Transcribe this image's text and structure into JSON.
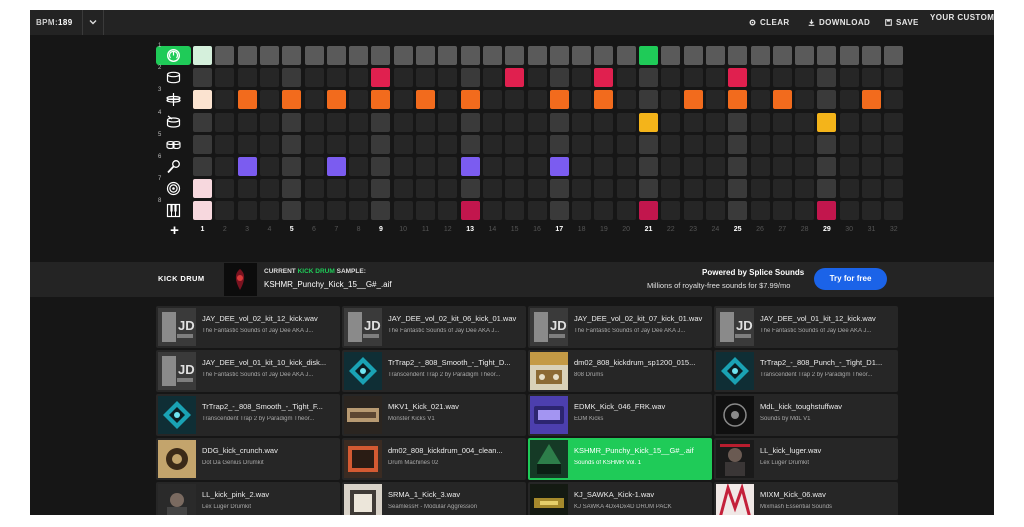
{
  "topbar": {
    "bpm_label": "BPM:",
    "bpm_value": "189",
    "clear_label": "CLEAR",
    "download_label": "DOWNLOAD",
    "save_label": "SAVE",
    "custom_label": "YOUR CUSTOM I"
  },
  "sequencer": {
    "rows": [
      {
        "num": "1",
        "icon": "volume-knob-icon",
        "active": true
      },
      {
        "num": "2",
        "icon": "kick-drum-icon",
        "active": false
      },
      {
        "num": "3",
        "icon": "hihat-cymbal-icon",
        "active": false
      },
      {
        "num": "4",
        "icon": "snare-drum-icon",
        "active": false
      },
      {
        "num": "5",
        "icon": "tom-drums-icon",
        "active": false
      },
      {
        "num": "6",
        "icon": "microphone-icon",
        "active": false
      },
      {
        "num": "7",
        "icon": "target-circle-icon",
        "active": false
      },
      {
        "num": "8",
        "icon": "piano-keys-icon",
        "active": false
      }
    ],
    "step_numbers": [
      "1",
      "2",
      "3",
      "4",
      "5",
      "6",
      "7",
      "8",
      "9",
      "10",
      "11",
      "12",
      "13",
      "14",
      "15",
      "16",
      "17",
      "18",
      "19",
      "20",
      "21",
      "22",
      "23",
      "24",
      "25",
      "26",
      "27",
      "28",
      "29",
      "30",
      "31",
      "32"
    ],
    "highlight_steps": [
      1,
      5,
      9,
      13,
      17,
      21,
      25,
      29
    ],
    "playhead_steps": [
      1,
      21
    ],
    "colors": {
      "accent": "#1fcb58",
      "off_cell": "#262626",
      "header_cell": "#5a5a5a",
      "beat_cell": "#3a3a3a",
      "kick": "#e0204f",
      "hihat": "#f26b1d",
      "snare": "#f4b41a",
      "vox": "#7b5cf0",
      "piano": "#c2164d",
      "playhead_pale": "#d5f0dc",
      "playhead_pale_hihat": "#fbe3d0",
      "playhead_pale_pink": "#f7d8de"
    },
    "active_cells": {
      "2": [
        9,
        15,
        19,
        25
      ],
      "3": [
        3,
        5,
        7,
        9,
        11,
        13,
        17,
        19,
        23,
        25,
        27,
        31
      ],
      "4": [
        21,
        29
      ],
      "6": [
        3,
        7,
        13,
        17
      ],
      "8": [
        13,
        21,
        29
      ]
    },
    "add_row": "+"
  },
  "infobar": {
    "instrument": "KICK DRUM",
    "current_prefix": "CURRENT ",
    "current_highlight": "KICK DRUM",
    "current_suffix": " SAMPLE:",
    "current_file": "KSHMR_Punchy_Kick_15__G#_.aif",
    "powered": "Powered by Splice Sounds",
    "pricing": "Millions of royalty-free sounds for $7.99/mo",
    "try_button": "Try for free"
  },
  "samples": [
    {
      "name": "JAY_DEE_vol_02_kit_12_kick.wav",
      "pack": "The Fantastic Sounds of Jay Dee AKA J...",
      "thumb": "jay-dee",
      "selected": false
    },
    {
      "name": "JAY_DEE_vol_02_kit_06_kick_01.wav",
      "pack": "The Fantastic Sounds of Jay Dee AKA J...",
      "thumb": "jay-dee",
      "selected": false
    },
    {
      "name": "JAY_DEE_vol_02_kit_07_kick_01.wav",
      "pack": "The Fantastic Sounds of Jay Dee AKA J...",
      "thumb": "jay-dee",
      "selected": false
    },
    {
      "name": "JAY_DEE_vol_01_kit_12_kick.wav",
      "pack": "The Fantastic Sounds of Jay Dee AKA J...",
      "thumb": "jay-dee",
      "selected": false
    },
    {
      "name": "JAY_DEE_vol_01_kit_10_kick_disk...",
      "pack": "The Fantastic Sounds of Jay Dee AKA J...",
      "thumb": "jay-dee",
      "selected": false
    },
    {
      "name": "TrTrap2_-_808_Smooth_-_Tight_D...",
      "pack": "Transcendent Trap 2 by Paradigm Theor...",
      "thumb": "trap",
      "selected": false
    },
    {
      "name": "dm02_808_kickdrum_sp1200_015...",
      "pack": "808 Drums",
      "thumb": "drums808",
      "selected": false
    },
    {
      "name": "TrTrap2_-_808_Punch_-_Tight_D1...",
      "pack": "Transcendent Trap 2 by Paradigm Theor...",
      "thumb": "trap",
      "selected": false
    },
    {
      "name": "TrTrap2_-_808_Smooth_-_Tight_F...",
      "pack": "Transcendent Trap 2 by Paradigm Theor...",
      "thumb": "trap",
      "selected": false
    },
    {
      "name": "MKV1_Kick_021.wav",
      "pack": "Monster Kicks V1",
      "thumb": "monster",
      "selected": false
    },
    {
      "name": "EDMK_Kick_046_FRK.wav",
      "pack": "EDM Kicks",
      "thumb": "edm",
      "selected": false
    },
    {
      "name": "MdL_kick_toughstuffwav",
      "pack": "Sounds by MdL V1",
      "thumb": "mdl",
      "selected": false
    },
    {
      "name": "DDG_kick_crunch.wav",
      "pack": "Dot Da Genius Drumkit",
      "thumb": "ddg",
      "selected": false
    },
    {
      "name": "dm02_808_kickdrum_004_clean...",
      "pack": "Drum Machines 02",
      "thumb": "drummachines",
      "selected": false
    },
    {
      "name": "KSHMR_Punchy_Kick_15__G#_.aif",
      "pack": "Sounds of KSHMR Vol. 1",
      "thumb": "kshmr",
      "selected": true
    },
    {
      "name": "LL_kick_luger.wav",
      "pack": "Lex Luger Drumkit",
      "thumb": "luger",
      "selected": false
    },
    {
      "name": "LL_kick_pink_2.wav",
      "pack": "Lex Luger Drumkit",
      "thumb": "luger2",
      "selected": false
    },
    {
      "name": "SRMA_1_Kick_3.wav",
      "pack": "SeamlessR - Modular Aggression",
      "thumb": "srma",
      "selected": false
    },
    {
      "name": "KJ_SAWKA_Kick-1.wav",
      "pack": "KJ SAWKA 4Dx4Dx4D DRUM PACK",
      "thumb": "sawka",
      "selected": false
    },
    {
      "name": "MIXM_Kick_06.wav",
      "pack": "Mixmash Essential Sounds",
      "thumb": "mixmash",
      "selected": false
    }
  ]
}
